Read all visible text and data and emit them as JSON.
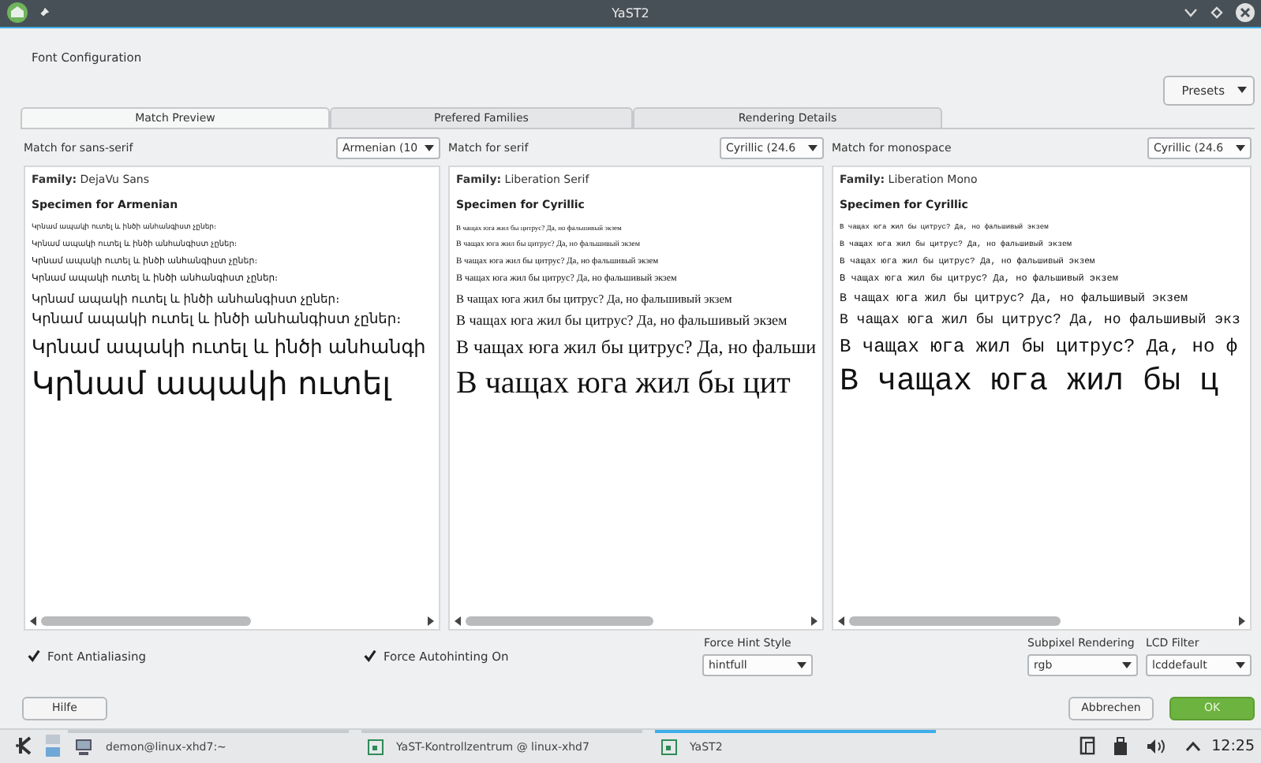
{
  "window": {
    "title": "YaST2"
  },
  "heading": "Font Configuration",
  "presets_button": "Presets",
  "tabs": [
    {
      "label": "Match Preview",
      "selected": true
    },
    {
      "label": "Prefered Families",
      "selected": false
    },
    {
      "label": "Rendering Details",
      "selected": false
    }
  ],
  "panels": [
    {
      "match_label": "Match for sans-serif",
      "dropdown": "Armenian (10",
      "family": "**Family:** DejaVu Sans",
      "specimen_title": "Specimen for Armenian",
      "kind": "sans",
      "lines": [
        "Կրնամ ապակի ուտել և ինծի անհանգիստ չըներ։",
        "Կրնամ ապակի ուտել և ինծի անհանգիստ չըներ։",
        "Կրնամ ապակի ուտել և ինծի անհանգիստ չըներ։",
        "Կրնամ ապակի ուտել և ինծի անհանգիստ չըներ։",
        "Կրնամ ապակի ուտել և ինծի անհանգիստ չըներ։",
        "Կրնամ ապակի ուտել և ինծի անհանգիստ չըներ։",
        "Կրնամ ապակի ուտել և ինծի անհանգի",
        "Կրնամ ապակի ուտել"
      ]
    },
    {
      "match_label": "Match for serif",
      "dropdown": "Cyrillic (24.6",
      "family": "**Family:** Liberation Serif",
      "specimen_title": "Specimen for Cyrillic",
      "kind": "serif",
      "lines": [
        "В чащах юга жил бы цитрус? Да, но фальшивый экзем",
        "В чащах юга жил бы цитрус? Да, но фальшивый экзем",
        "В чащах юга жил бы цитрус? Да, но фальшивый экзем",
        "В чащах юга жил бы цитрус? Да, но фальшивый экзем",
        "В чащах юга жил бы цитрус? Да, но фальшивый экзем",
        "В чащах юга жил бы цитрус? Да, но фальшивый экзем",
        "В чащах юга жил бы цитрус? Да, но фальши",
        "В чащах юга жил бы цит"
      ]
    },
    {
      "match_label": "Match for monospace",
      "dropdown": "Cyrillic (24.6",
      "family": "**Family:** Liberation Mono",
      "specimen_title": "Specimen for Cyrillic",
      "kind": "mono",
      "lines": [
        "В чащах юга жил бы цитрус? Да, но фальшивый экзем",
        "В чащах юга жил бы цитрус? Да, но фальшивый экзем",
        "В чащах юга жил бы цитрус? Да, но фальшивый экзем",
        "В чащах юга жил бы цитрус? Да, но фальшивый экзем",
        "В чащах юга жил бы цитрус? Да, но фальшивый экзем",
        "В чащах юга жил бы цитрус? Да, но фальшивый экз",
        "В чащах юга жил бы цитрус? Да, но ф",
        "В чащах юга жил бы ц"
      ]
    }
  ],
  "checkboxes": [
    {
      "label": "Font Antialiasing",
      "checked": true
    },
    {
      "label": "Force Autohinting On",
      "checked": true
    }
  ],
  "hint_style": {
    "label": "Force Hint Style",
    "value": "hintfull"
  },
  "subpixel": {
    "label": "Subpixel Rendering",
    "value": "rgb"
  },
  "lcd_filter": {
    "label": "LCD Filter",
    "value": "lcddefault"
  },
  "buttons": {
    "help": "Hilfe",
    "cancel": "Abbrechen",
    "ok": "OK"
  },
  "taskbar": {
    "items": [
      {
        "label": "demon@linux-xhd7:~",
        "kind": "terminal",
        "active": false
      },
      {
        "label": "YaST-Kontrollzentrum @ linux-xhd7",
        "kind": "app",
        "active": false
      },
      {
        "label": "YaST2",
        "kind": "app",
        "active": true
      }
    ],
    "clock": "12:25"
  }
}
